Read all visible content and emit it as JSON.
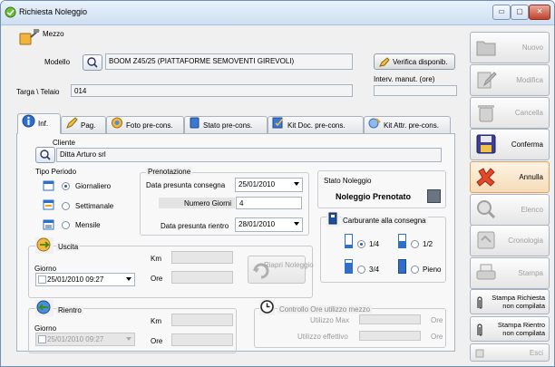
{
  "window": {
    "title": "Richiesta Noleggio",
    "controls": {
      "minimize": "▭",
      "maximize": "▢",
      "close": "✕"
    }
  },
  "mezzo": {
    "section_title": "Mezzo",
    "modello_label": "Modello",
    "modello_value": "BOOM Z45/25 (PIATTAFORME SEMOVENTI GIREVOLI)",
    "verifica_label": "Verifica disponib.",
    "interv_label": "Interv. manut. (ore)",
    "targa_label": "Targa \\ Telaio",
    "targa_value": "014"
  },
  "tabs": [
    {
      "label": "Inf."
    },
    {
      "label": "Pag."
    },
    {
      "label": "Foto pre-cons."
    },
    {
      "label": "Stato pre-cons."
    },
    {
      "label": "Kit Doc. pre-cons."
    },
    {
      "label": "Kit Attr. pre-cons."
    }
  ],
  "cliente": {
    "label": "Cliente",
    "value": "Ditta Arturo srl"
  },
  "tipo_periodo": {
    "title": "Tipo Periodo",
    "options": [
      {
        "label": "Giornaliero",
        "selected": true
      },
      {
        "label": "Settimanale",
        "selected": false
      },
      {
        "label": "Mensile",
        "selected": false
      }
    ]
  },
  "prenotazione": {
    "title": "Prenotazione",
    "consegna_label": "Data presunta consegna",
    "consegna_value": "25/01/2010",
    "giorni_label": "Numero Giorni",
    "giorni_value": "4",
    "rientro_label": "Data presunta rientro",
    "rientro_value": "28/01/2010"
  },
  "stato_noleggio": {
    "title": "Stato Noleggio",
    "value": "Noleggio Prenotato"
  },
  "carburante": {
    "title": "Carburante alla consegna",
    "options": [
      {
        "label": "1/4",
        "selected": true
      },
      {
        "label": "1/2",
        "selected": false
      },
      {
        "label": "3/4",
        "selected": false
      },
      {
        "label": "Pieno",
        "selected": false
      }
    ]
  },
  "uscita": {
    "title": "Uscita",
    "giorno_label": "Giorno",
    "giorno_value": "25/01/2010 09:27",
    "km_label": "Km",
    "ore_label": "Ore",
    "riapri_label": "Riapri Noleggio"
  },
  "rientro": {
    "title": "Rientro",
    "giorno_label": "Giorno",
    "giorno_value": "25/01/2010 09:27",
    "km_label": "Km",
    "ore_label": "Ore"
  },
  "controllo_ore": {
    "title": "Controllo Ore utilizzo mezzo",
    "max_label": "Utilizzo Max",
    "eff_label": "Utilizzo effettivo",
    "unit": "Ore"
  },
  "side_buttons": {
    "nuovo": "Nuovo",
    "modifica": "Modifica",
    "cancella": "Cancella",
    "conferma": "Conferma",
    "annulla": "Annulla",
    "elenco": "Elenco",
    "cronologia": "Cronologia",
    "stampa": "Stampa",
    "stampa_richiesta": "Stampa Richiesta\nnon compilata",
    "stampa_rientro": "Stampa Rientro\nnon compilata",
    "esci": "Esci"
  },
  "colors": {
    "accent": "#2b5aa8",
    "title_bar": "#cfdff1",
    "active_button": "#f6dcb8"
  }
}
